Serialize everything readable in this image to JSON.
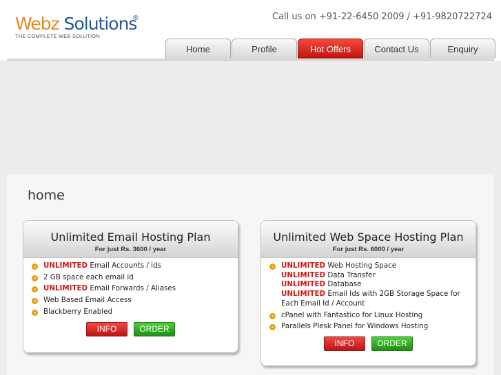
{
  "logo": {
    "part1": "Webz",
    "part2": " Solutions",
    "reg": "®",
    "tagline": "THE COMPLETE WEB SOLUTION"
  },
  "phone": "Call us on +91-22-6450 2009 / +91-9820722724",
  "nav": [
    "Home",
    "Profile",
    "Hot Offers",
    "Contact Us",
    "Enquiry"
  ],
  "page_heading": "home",
  "plans": [
    {
      "title": "Unlimited Email Hosting Plan",
      "subtitle": "For just Rs. 3600 / year",
      "features": [
        {
          "hl": "UNLIMITED",
          "text": " Email Accounts / ids"
        },
        {
          "hl": "",
          "text": "2 GB space each email id"
        },
        {
          "hl": "UNLIMITED",
          "text": " Email Forwards / Aliases"
        },
        {
          "hl": "",
          "text": "Web Based Email Access"
        },
        {
          "hl": "",
          "text": "Blackberry Enabled"
        }
      ],
      "buttons": {
        "info": "INFO",
        "order": "ORDER"
      }
    },
    {
      "title": "Unlimited Web Space Hosting Plan",
      "subtitle": "For just Rs. 6000 / year",
      "features": [
        {
          "hl1": "UNLIMITED",
          "t1": " Web Hosting Space",
          "hl2": "UNLIMITED",
          "t2": " Data Transfer",
          "hl3": "UNLIMITED",
          "t3": " Database",
          "hl4": "UNLIMITED",
          "t4": " Email Ids with 2GB Storage Space for Each Email Id / Account"
        },
        {
          "hl": "",
          "text": "cPanel with Fantastico for Linux Hosting"
        },
        {
          "hl": "",
          "text": "Parallels Plesk Panel for Windows Hosting"
        }
      ],
      "buttons": {
        "info": "INFO",
        "order": "ORDER"
      }
    }
  ]
}
